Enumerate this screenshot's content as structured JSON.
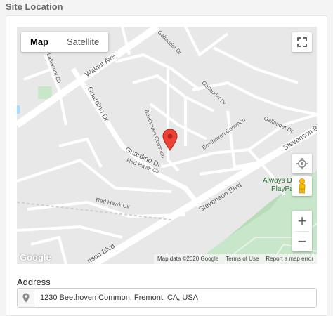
{
  "section_title": "Site Location",
  "map": {
    "map_type_buttons": [
      {
        "label": "Map",
        "active": true
      },
      {
        "label": "Satellite",
        "active": false
      }
    ],
    "street_labels": {
      "walnut_ave": "Walnut Ave",
      "lakefront_cir": "Lakefront Cir",
      "guardino_dr_top": "Guardino Dr",
      "beethoven_common_v": "Beethoven Common",
      "beethoven_common_h": "Beethoven Common",
      "gallaudet_dr_top": "Gallaudet Dr",
      "gallaudet_dr_mid": "Gallaudet Dr",
      "gallaudet_dr_right": "Gallaudet Dr",
      "guardino_dr_bottom": "Guardino Dr",
      "red_hawk_cir_top": "Red Hawk Cir",
      "red_hawk_cir_bottom": "Red Hawk Cir",
      "stevenson_blvd_mid": "Stevenson Blvd",
      "stevenson_blvd_right": "Stevenson Blvd",
      "stevenson_blvd_bottom": "nson Blvd",
      "park_line1": "Always Drea",
      "park_line2": "PlayPark"
    },
    "google_logo": "Google",
    "attribution": {
      "map_data": "Map data ©2020 Google",
      "terms": "Terms of Use",
      "report": "Report a map error"
    },
    "colors": {
      "marker": "#ea4335",
      "park": "#c8e6c9",
      "road": "#ffffff",
      "land": "#e8e8e8"
    }
  },
  "address": {
    "label": "Address",
    "value": "1230 Beethoven Common, Fremont, CA, USA",
    "icon": "map-pin-icon"
  }
}
